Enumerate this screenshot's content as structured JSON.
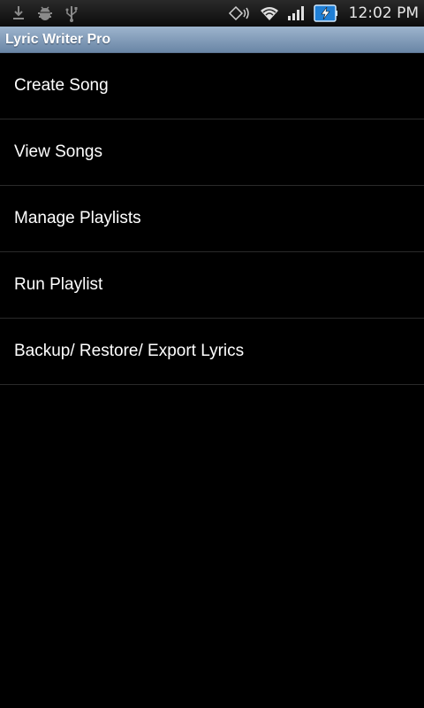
{
  "status_bar": {
    "time": "12:02 PM",
    "left_icons": [
      "download-icon",
      "android-debug-icon",
      "usb-icon"
    ],
    "right_icons": [
      "vibrate-icon",
      "wifi-icon",
      "signal-icon",
      "battery-charging-icon"
    ]
  },
  "app": {
    "title": "Lyric Writer Pro"
  },
  "menu": {
    "items": [
      {
        "label": "Create Song"
      },
      {
        "label": "View Songs"
      },
      {
        "label": "Manage Playlists"
      },
      {
        "label": "Run Playlist"
      },
      {
        "label": "Backup/ Restore/ Export Lyrics"
      }
    ]
  }
}
